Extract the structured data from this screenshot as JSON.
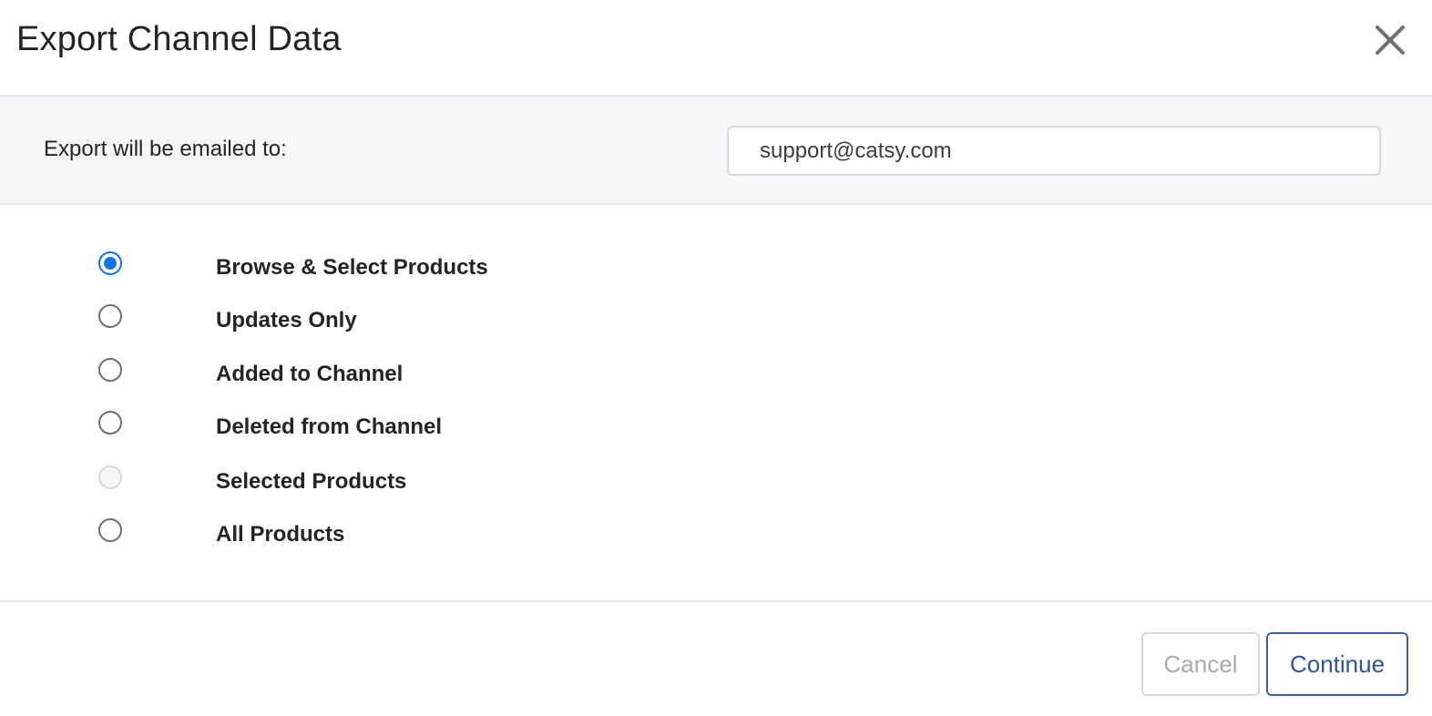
{
  "dialog": {
    "title": "Export Channel Data",
    "close_icon": "close-icon"
  },
  "email": {
    "label": "Export will be emailed to:",
    "value": "support@catsy.com"
  },
  "options": [
    {
      "label": "Browse & Select Products",
      "selected": true,
      "disabled": false
    },
    {
      "label": "Updates Only",
      "selected": false,
      "disabled": false
    },
    {
      "label": "Added to Channel",
      "selected": false,
      "disabled": false
    },
    {
      "label": "Deleted from Channel",
      "selected": false,
      "disabled": false
    },
    {
      "label": "Selected Products",
      "selected": false,
      "disabled": true
    },
    {
      "label": "All Products",
      "selected": false,
      "disabled": false
    }
  ],
  "footer": {
    "cancel_label": "Cancel",
    "continue_label": "Continue"
  },
  "colors": {
    "accent": "#1473e6",
    "continue_border": "#3e5e9c",
    "band_background": "#f6f7f9"
  }
}
